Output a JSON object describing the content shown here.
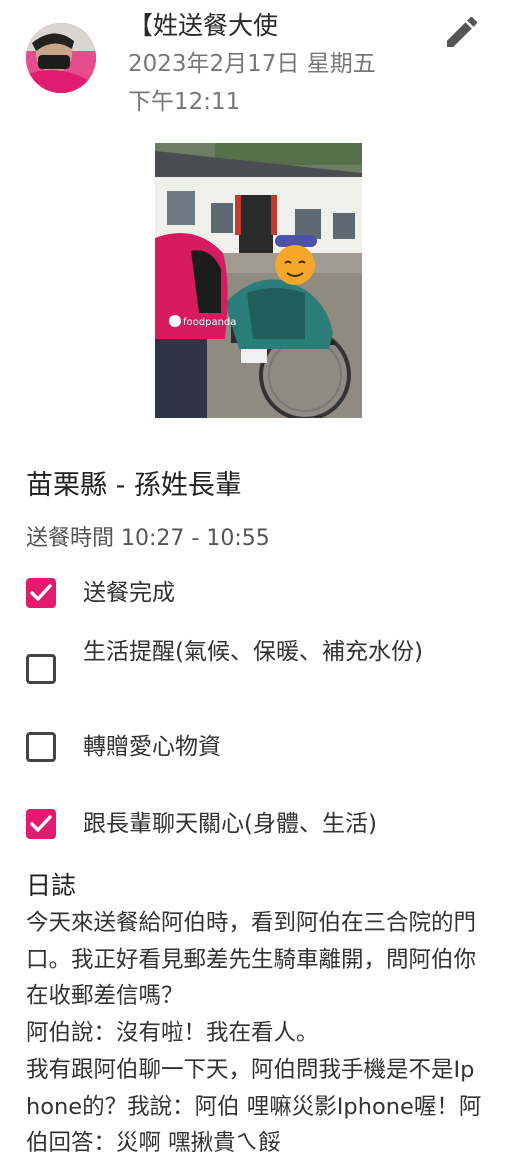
{
  "post": {
    "author": "【姓送餐大使",
    "date": "2023年2月17日 星期五",
    "time": "下午12:11"
  },
  "photo": {
    "helmet_text": "foodpanda"
  },
  "record": {
    "title": "苗栗縣 - 孫姓長輩",
    "delivery_time": "送餐時間 10:27 - 10:55"
  },
  "checklist": [
    {
      "label": "送餐完成",
      "checked": true
    },
    {
      "label": "生活提醒(氣候、保暖、補充水份)",
      "checked": false
    },
    {
      "label": "轉贈愛心物資",
      "checked": false
    },
    {
      "label": "跟長輩聊天關心(身體、生活)",
      "checked": true
    }
  ],
  "log": {
    "heading": "日誌",
    "body": "今天來送餐給阿伯時，看到阿伯在三合院的門口。我正好看見郵差先生騎車離開，問阿伯你在收郵差信嗎？\n阿伯說：沒有啦！我在看人。\n我有跟阿伯聊一下天，阿伯問我手機是不是Iphone的？我說：阿伯 哩嘛災影Iphone喔！阿伯回答：災啊 嘿揪貴ㄟ餒"
  },
  "colors": {
    "accent": "#e21b70",
    "muted_text": "#777777"
  }
}
